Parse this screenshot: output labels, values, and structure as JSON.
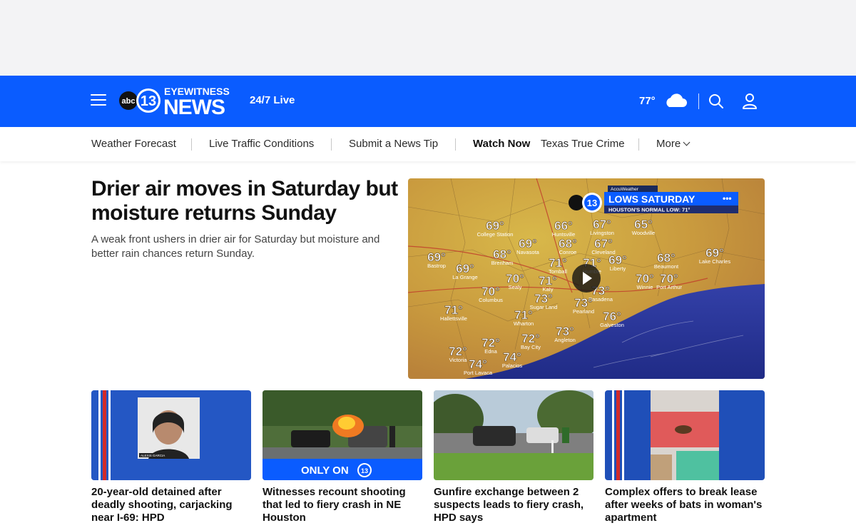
{
  "header": {
    "brand_top": "EYEWITNESS",
    "brand_bottom": "NEWS",
    "brand_badge": "abc",
    "brand_number": "13",
    "live_label": "24/7 Live",
    "temperature": "77°",
    "weather_icon": "cloud-icon",
    "brand_color": "#0a5cff"
  },
  "subnav": {
    "items": [
      {
        "label": "Weather Forecast"
      },
      {
        "label": "Live Traffic Conditions"
      },
      {
        "label": "Submit a News Tip"
      },
      {
        "label": "Watch Now"
      },
      {
        "label": "Texas True Crime"
      },
      {
        "label": "More"
      }
    ]
  },
  "lead": {
    "headline": "Drier air moves in Saturday but moisture returns Sunday",
    "dek": "A weak front ushers in drier air for Saturday but moisture and better rain chances return Sunday."
  },
  "weather_graphic": {
    "credit": "AccuWeather",
    "title": "LOWS SATURDAY",
    "subtitle": "HOUSTON'S NORMAL LOW: 71°",
    "cities": [
      {
        "name": "College Station",
        "temp": "69°"
      },
      {
        "name": "Huntsville",
        "temp": "66°"
      },
      {
        "name": "Livingston",
        "temp": "67°"
      },
      {
        "name": "Woodville",
        "temp": "65°"
      },
      {
        "name": "Navasota",
        "temp": "69°"
      },
      {
        "name": "Conroe",
        "temp": "68°"
      },
      {
        "name": "Cleveland",
        "temp": "67°"
      },
      {
        "name": "Bastrop",
        "temp": "69°"
      },
      {
        "name": "Brenham",
        "temp": "68°"
      },
      {
        "name": "La Grange",
        "temp": "69°"
      },
      {
        "name": "Tomball",
        "temp": "71°"
      },
      {
        "name": "Humble",
        "temp": "71°"
      },
      {
        "name": "Liberty",
        "temp": "69°"
      },
      {
        "name": "Beaumont",
        "temp": "68°"
      },
      {
        "name": "Lake Charles",
        "temp": "69°"
      },
      {
        "name": "Sealy",
        "temp": "70°"
      },
      {
        "name": "Katy",
        "temp": "71°"
      },
      {
        "name": "Winnie",
        "temp": "70°"
      },
      {
        "name": "Port Arthur",
        "temp": "70°"
      },
      {
        "name": "Columbus",
        "temp": "70°"
      },
      {
        "name": "Pasadena",
        "temp": "73°"
      },
      {
        "name": "Sugar Land",
        "temp": "73°"
      },
      {
        "name": "Pearland",
        "temp": "73°"
      },
      {
        "name": "Hallettsville",
        "temp": "71°"
      },
      {
        "name": "Wharton",
        "temp": "71°"
      },
      {
        "name": "Galveston",
        "temp": "76°"
      },
      {
        "name": "Angleton",
        "temp": "73°"
      },
      {
        "name": "Edna",
        "temp": "72°"
      },
      {
        "name": "Bay City",
        "temp": "72°"
      },
      {
        "name": "Victoria",
        "temp": "72°"
      },
      {
        "name": "Palacios",
        "temp": "74°"
      },
      {
        "name": "Port Lavaca",
        "temp": "74°"
      }
    ]
  },
  "stories": [
    {
      "title": "20-year-old detained after deadly shooting, carjacking near I-69: HPD",
      "thumb_caption": "ALEXIS GARCIA"
    },
    {
      "title": "Witnesses recount shooting that led to fiery crash in NE Houston",
      "thumb_caption": "ONLY ON"
    },
    {
      "title": "Gunfire exchange between 2 suspects leads to fiery crash, HPD says"
    },
    {
      "title": "Complex offers to break lease after weeks of bats in woman's apartment"
    }
  ]
}
